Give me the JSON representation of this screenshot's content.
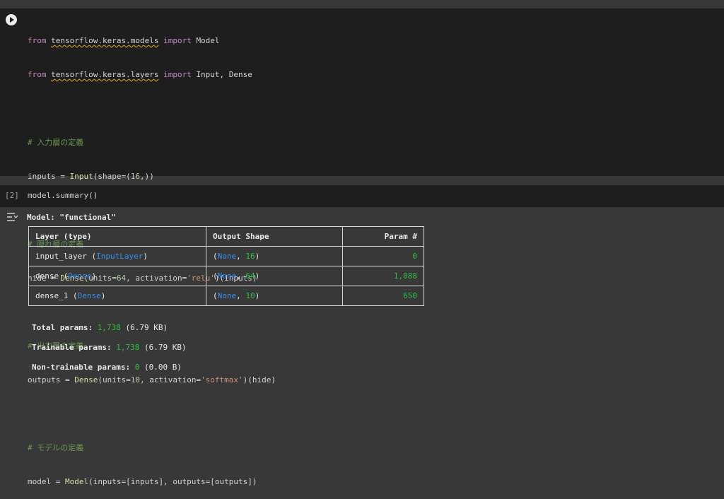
{
  "cell1": {
    "lines": [
      [
        "from ",
        "tensorflow.keras.models",
        " import ",
        "Model"
      ],
      [
        "from ",
        "tensorflow.keras.layers",
        " import ",
        "Input, Dense"
      ],
      [
        ""
      ],
      [
        "# 入力層の定義"
      ],
      [
        "inputs = Input(shape=(16,))"
      ],
      [
        ""
      ],
      [
        "# 隠れ層の定義"
      ],
      [
        "hide = Dense(units=64, activation='relu')(inputs)"
      ],
      [
        ""
      ],
      [
        "# 出力層の定義"
      ],
      [
        "outputs = Dense(units=10, activation='softmax')(hide)"
      ],
      [
        ""
      ],
      [
        "# モデルの定義"
      ],
      [
        "model = Model(inputs=[inputs], outputs=[outputs])"
      ]
    ]
  },
  "cell2": {
    "exec_count": "[2]",
    "code": "model.summary()"
  },
  "output": {
    "model_title": "Model: \"functional\"",
    "table": {
      "headers": [
        "Layer (type)",
        "Output Shape",
        "Param #"
      ],
      "rows": [
        {
          "name": "input_layer",
          "type": "InputLayer",
          "shape_none": "None",
          "shape_num": "16",
          "params": "0"
        },
        {
          "name": "dense",
          "type": "Dense",
          "shape_none": "None",
          "shape_num": "64",
          "params": "1,088"
        },
        {
          "name": "dense_1",
          "type": "Dense",
          "shape_none": "None",
          "shape_num": "10",
          "params": "650"
        }
      ]
    },
    "totals": {
      "total_label": "Total params:",
      "total_value": "1,738",
      "total_size": "(6.79 KB)",
      "trainable_label": "Trainable params:",
      "trainable_value": "1,738",
      "trainable_size": "(6.79 KB)",
      "nontrainable_label": "Non-trainable params:",
      "nontrainable_value": "0",
      "nontrainable_size": "(0.00 B)"
    }
  }
}
